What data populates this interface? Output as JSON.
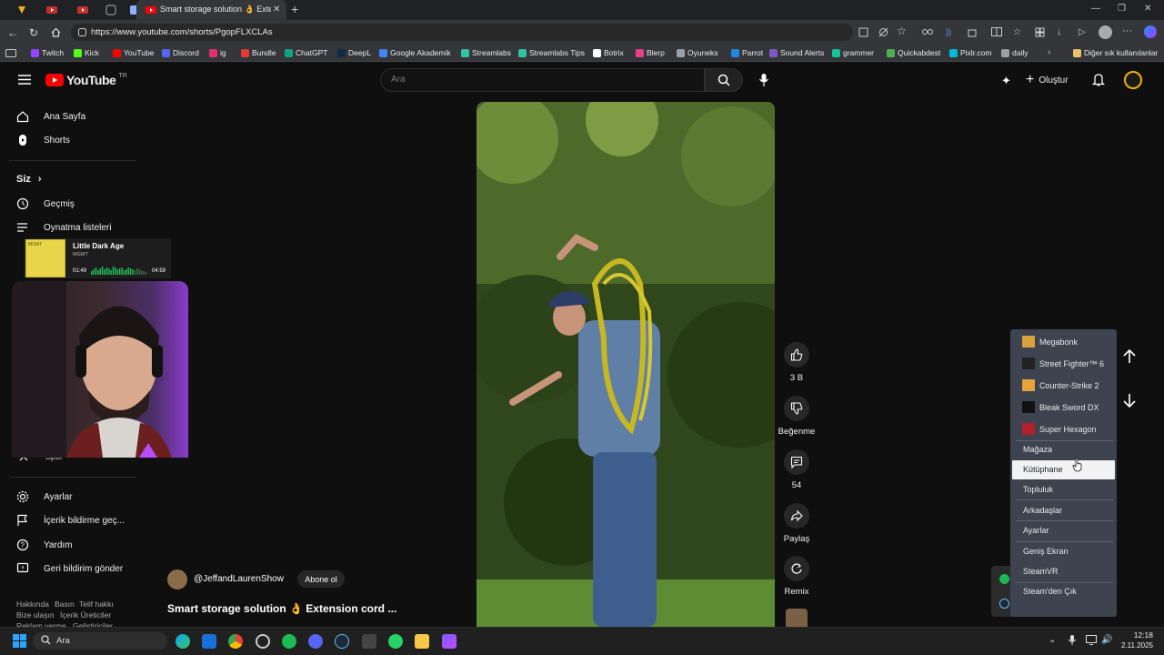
{
  "browser": {
    "active_tab_title": "Smart storage solution 👌 Extensi",
    "url": "https://www.youtube.com/shorts/PgopFLXCLAs",
    "bookmarks": [
      "Twitch",
      "Kick",
      "YouTube",
      "Discord",
      "ig",
      "Bundle",
      "ChatGPT",
      "DeepL",
      "Google Akademik",
      "Streamlabs",
      "Streamlabs Tips",
      "Botrix",
      "Blerp",
      "Oyuneks",
      "Parrot",
      "Sound Alerts",
      "grammer",
      "Quickabdest",
      "Pixlr.com",
      "daily"
    ],
    "bookmark_colors": [
      "#9146ff",
      "#53fc18",
      "#ff0000",
      "#5865f2",
      "#e1306c",
      "#e53935",
      "#10a37f",
      "#0f2b46",
      "#4285f4",
      "#31c3a2",
      "#31c3a2",
      "#ffffff",
      "#e83e8c",
      "#9aa0a6",
      "#1e88e5",
      "#7e57c2",
      "#15c39a",
      "#4caf50",
      "#00bcd4",
      "#9aa0a6"
    ],
    "other_bookmarks": "Diğer sık kullanılanlar"
  },
  "youtube": {
    "logo_text": "YouTube",
    "region": "TR",
    "search_placeholder": "Ara",
    "create_label": "Oluştur",
    "sidebar_top": [
      "Ana Sayfa",
      "Shorts"
    ],
    "you_section": "Siz",
    "sidebar_you": [
      "Geçmiş",
      "Oynatma listeleri"
    ],
    "sidebar_partial": "Spor",
    "sidebar_bottom": [
      "Ayarlar",
      "İçerik bildirme geç...",
      "Yardım",
      "Geri bildirim gönder"
    ],
    "footer": [
      "Hakkında",
      "Basın",
      "Telif hakkı",
      "Bize ulaşın",
      "İçerik Üreticiler",
      "Reklam verme",
      "Geliştiriciler"
    ]
  },
  "short": {
    "channel": "@JeffandLaurenShow",
    "subscribe": "Abone ol",
    "title": "Smart storage solution 👌 Extension cord ...",
    "likes": "3 B",
    "dislike_label": "Beğenme",
    "comments": "54",
    "share_label": "Paylaş",
    "remix_label": "Remix"
  },
  "now_playing": {
    "title": "Little Dark Age",
    "artist": "MGMT",
    "album_text": "MGMT",
    "elapsed": "01:49",
    "duration": "04:59",
    "progress": 0.365
  },
  "steam_menu": {
    "games": [
      {
        "name": "Megabonk",
        "color": "#d9a23a"
      },
      {
        "name": "Street Fighter™ 6",
        "color": "#222222"
      },
      {
        "name": "Counter-Strike 2",
        "color": "#e8a33d"
      },
      {
        "name": "Bleak Sword DX",
        "color": "#111111"
      },
      {
        "name": "Super Hexagon",
        "color": "#b3202d"
      }
    ],
    "items": [
      "Mağaza",
      "Kütüphane",
      "Topluluk",
      "Arkadaşlar",
      "Ayarlar",
      "Geniş Ekran",
      "SteamVR",
      "Steam'den Çık"
    ],
    "highlighted": "Kütüphane"
  },
  "taskbar": {
    "search": "Ara",
    "time": "12:18",
    "date": "2.11.2025"
  }
}
